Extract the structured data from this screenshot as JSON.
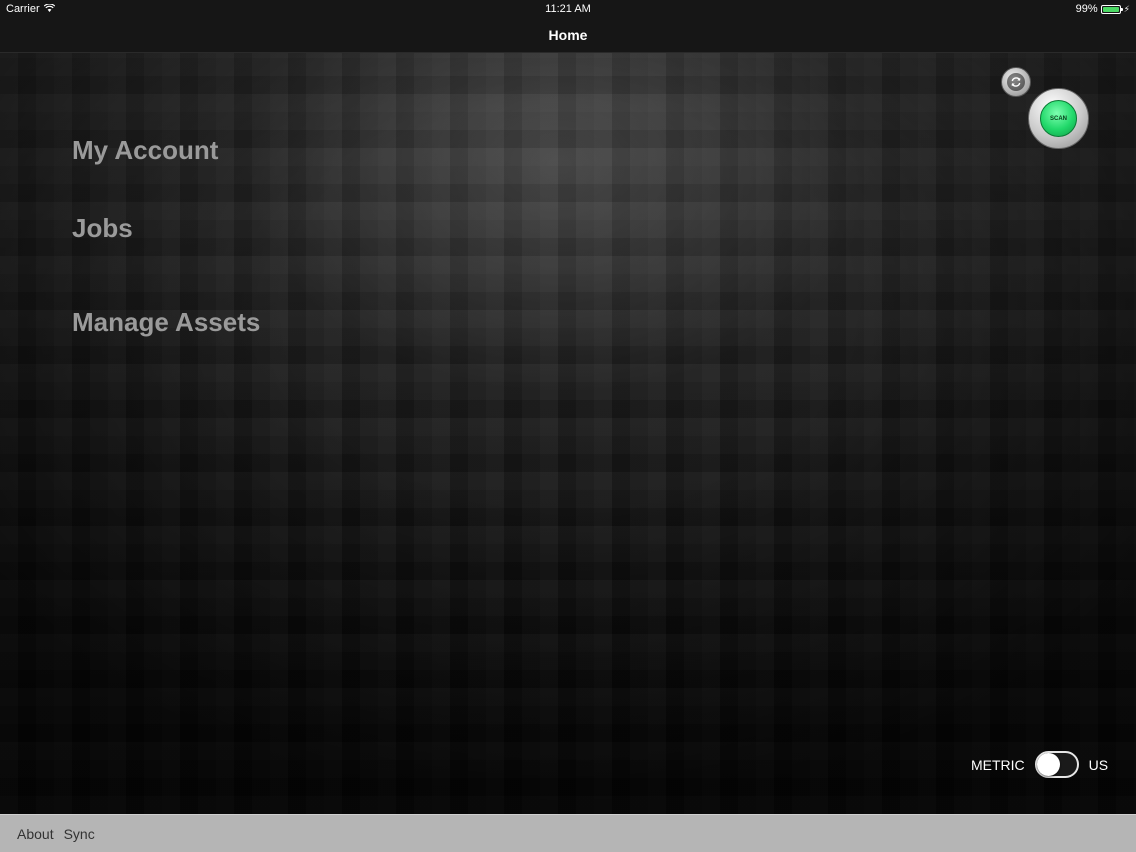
{
  "status_bar": {
    "carrier": "Carrier",
    "wifi_icon": "wifi-icon",
    "time": "11:21 AM",
    "battery_percent": "99%",
    "battery_level": 0.99,
    "battery_color": "#4cd964"
  },
  "nav": {
    "title": "Home"
  },
  "menu": {
    "items": [
      {
        "label": "My Account"
      },
      {
        "label": "Jobs"
      },
      {
        "label": "Manage Assets"
      }
    ]
  },
  "actions": {
    "refresh_icon": "refresh-icon",
    "scan_label": "SCAN",
    "scan_color": "#21d86a"
  },
  "units": {
    "left_label": "METRIC",
    "right_label": "US",
    "selected": "METRIC"
  },
  "toolbar": {
    "about_label": "About",
    "sync_label": "Sync"
  }
}
